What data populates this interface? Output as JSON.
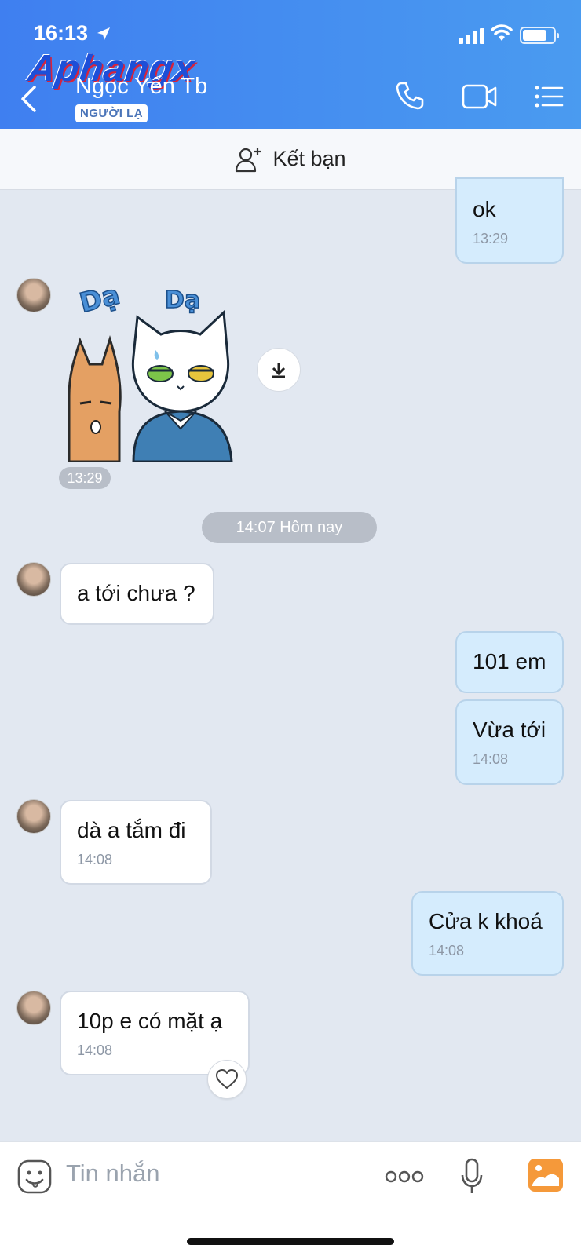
{
  "status_bar": {
    "time": "16:13"
  },
  "watermark": "Aphangx",
  "header": {
    "contact_name": "Ngọc Yến Tb",
    "badge": "NGƯỜI LẠ"
  },
  "friend_bar": {
    "label": "Kết bạn"
  },
  "messages": [
    {
      "side": "out",
      "text": "ok",
      "time": "13:29"
    },
    {
      "side": "in",
      "type": "sticker",
      "sticker_text": [
        "Dạ",
        "Dạ"
      ],
      "time": "13:29"
    },
    {
      "side": "in",
      "text": "a tới chưa ?"
    },
    {
      "side": "out",
      "text": "101 em"
    },
    {
      "side": "out",
      "text": "Vừa tới",
      "time": "14:08"
    },
    {
      "side": "in",
      "text": "dà a tắm đi",
      "time": "14:08"
    },
    {
      "side": "out",
      "text": "Cửa k khoá",
      "time": "14:08"
    },
    {
      "side": "in",
      "text": "10p e có mặt ạ",
      "time": "14:08"
    }
  ],
  "date_divider": "14:07 Hôm nay",
  "composer": {
    "placeholder": "Tin nhắn"
  },
  "colors": {
    "header_start": "#3f7ff0",
    "header_end": "#4a9bf0",
    "outgoing_bubble": "#d5ecfd",
    "background": "#e2e8f1",
    "image_button": "#f5993a"
  }
}
